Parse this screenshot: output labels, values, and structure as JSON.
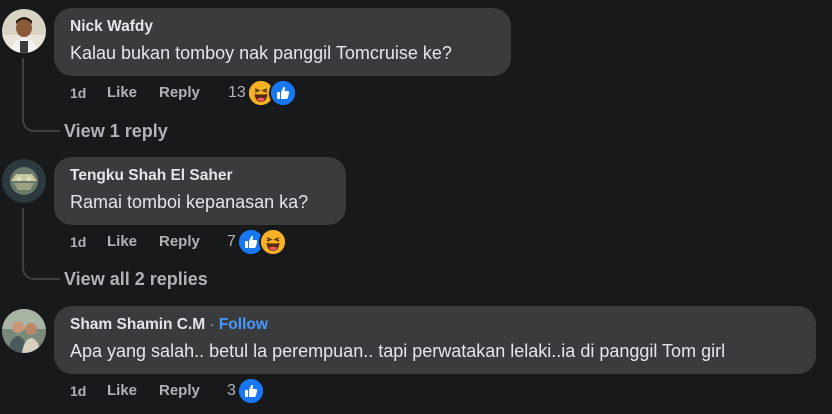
{
  "comments": [
    {
      "author": "Nick Wafdy",
      "text": "Kalau bukan tomboy nak panggil Tomcruise ke?",
      "time": "1d",
      "like_label": "Like",
      "reply_label": "Reply",
      "reaction_count": "13",
      "reactions": [
        "haha",
        "like"
      ],
      "view_replies": "View 1 reply"
    },
    {
      "author": "Tengku Shah El Saher",
      "text": "Ramai tomboi kepanasan ka?",
      "time": "1d",
      "like_label": "Like",
      "reply_label": "Reply",
      "reaction_count": "7",
      "reactions": [
        "like",
        "haha"
      ],
      "view_replies": "View all 2 replies"
    },
    {
      "author": "Sham Shamin C.M",
      "separator": "·",
      "follow_label": "Follow",
      "text": "Apa yang salah.. betul la perempuan.. tapi perwatakan lelaki..ia di panggil Tom girl",
      "time": "1d",
      "like_label": "Like",
      "reply_label": "Reply",
      "reaction_count": "3",
      "reactions": [
        "like"
      ]
    }
  ],
  "colors": {
    "background": "#18191a",
    "bubble": "#3a3b3c",
    "primary_text": "#e4e6eb",
    "secondary_text": "#b0b3b8",
    "follow": "#4599ff",
    "like_reaction": "#1877f2",
    "haha_reaction": "#f7b125"
  }
}
